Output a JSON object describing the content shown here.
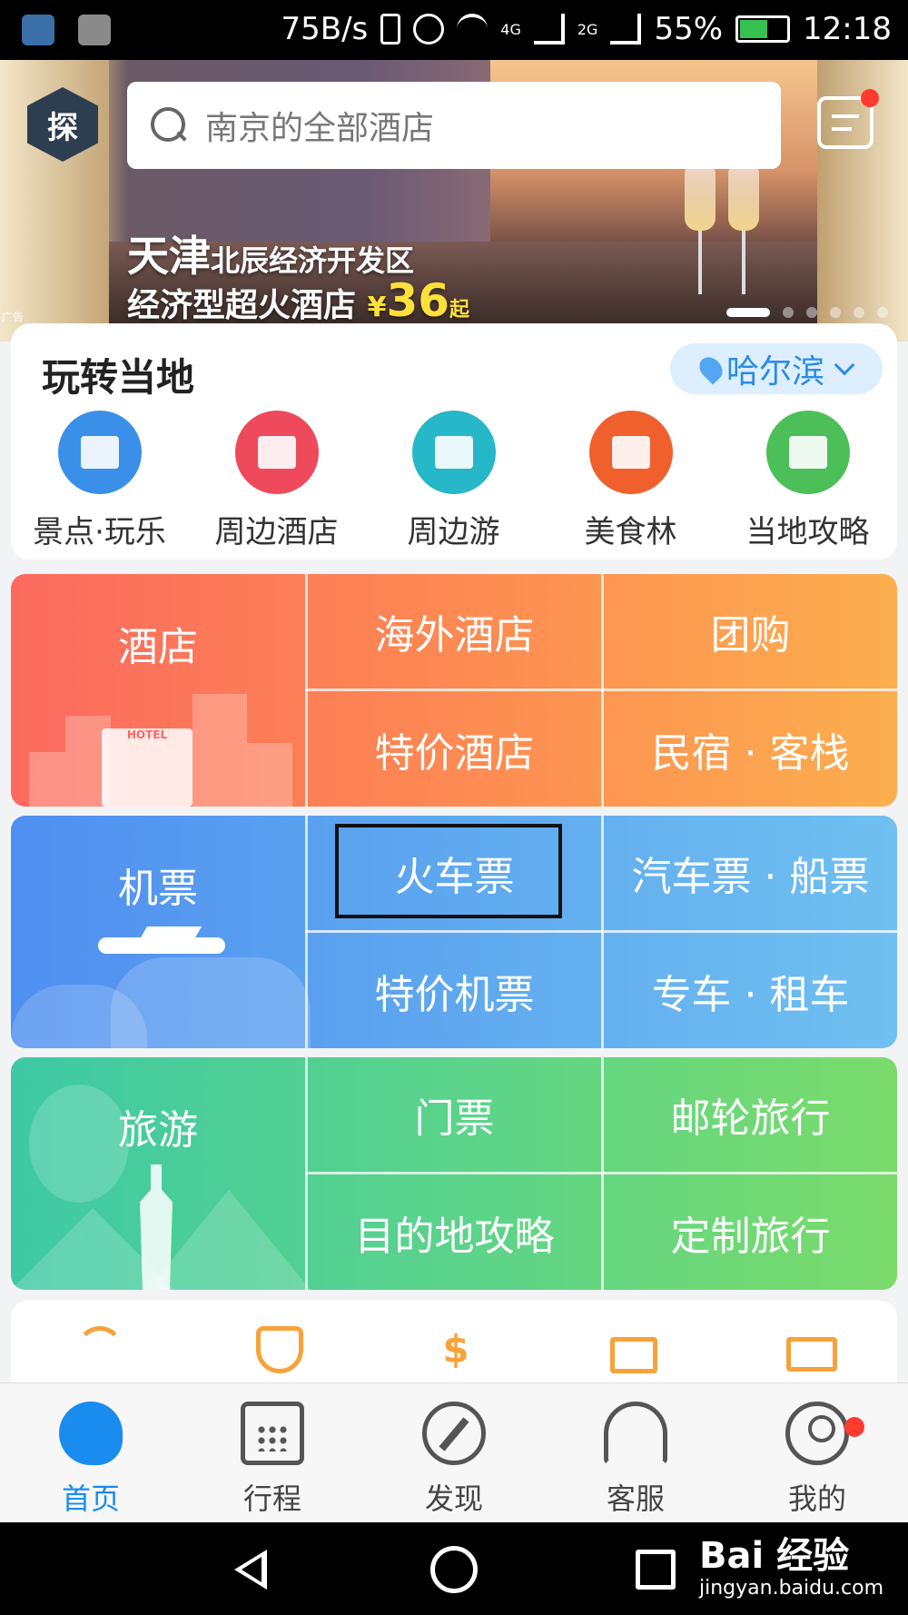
{
  "status_bar": {
    "net_speed": "75B/s",
    "net1": "4G",
    "net2": "2G",
    "battery": "55%",
    "time": "12:18"
  },
  "search": {
    "placeholder": "南京的全部酒店"
  },
  "banner": {
    "city": "天津",
    "area": "北辰经济开发区",
    "headline": "经济型超火酒店",
    "currency": "¥",
    "price": "36",
    "suffix": "起",
    "ad_tag": "广告"
  },
  "local": {
    "title": "玩转当地",
    "city": "哈尔滨",
    "items": [
      {
        "label": "景点·玩乐",
        "color": "#3a8fe8",
        "icon": "pavilion-icon"
      },
      {
        "label": "周边酒店",
        "color": "#ef4a5c",
        "icon": "hotel-building-icon"
      },
      {
        "label": "周边游",
        "color": "#26b7c9",
        "icon": "mountain-icon"
      },
      {
        "label": "美食林",
        "color": "#f0602d",
        "icon": "dolphin-badge-icon"
      },
      {
        "label": "当地攻略",
        "color": "#4cbf58",
        "icon": "map-pin-icon"
      }
    ]
  },
  "grid": {
    "hotel": {
      "main": "酒店",
      "cells": [
        "海外酒店",
        "团购",
        "特价酒店",
        "民宿 · 客栈"
      ],
      "deco_text": "HOTEL"
    },
    "flight": {
      "main": "机票",
      "cells": [
        "火车票",
        "汽车票 · 船票",
        "特价机票",
        "专车 · 租车"
      ]
    },
    "travel": {
      "main": "旅游",
      "cells": [
        "门票",
        "邮轮旅行",
        "目的地攻略",
        "定制旅行"
      ]
    }
  },
  "services": [
    "wifi-icon",
    "shield-icon",
    "currency-exchange-icon",
    "shopping-bag-icon",
    "ticket-icon"
  ],
  "tabs": [
    {
      "label": "首页",
      "icon": "home-dolphin-icon",
      "active": true
    },
    {
      "label": "行程",
      "icon": "calendar-icon",
      "active": false
    },
    {
      "label": "发现",
      "icon": "compass-icon",
      "active": false
    },
    {
      "label": "客服",
      "icon": "headset-icon",
      "active": false
    },
    {
      "label": "我的",
      "icon": "user-icon",
      "active": false
    }
  ],
  "watermark": {
    "brand": "Bai 经验",
    "url": "jingyan.baidu.com"
  }
}
